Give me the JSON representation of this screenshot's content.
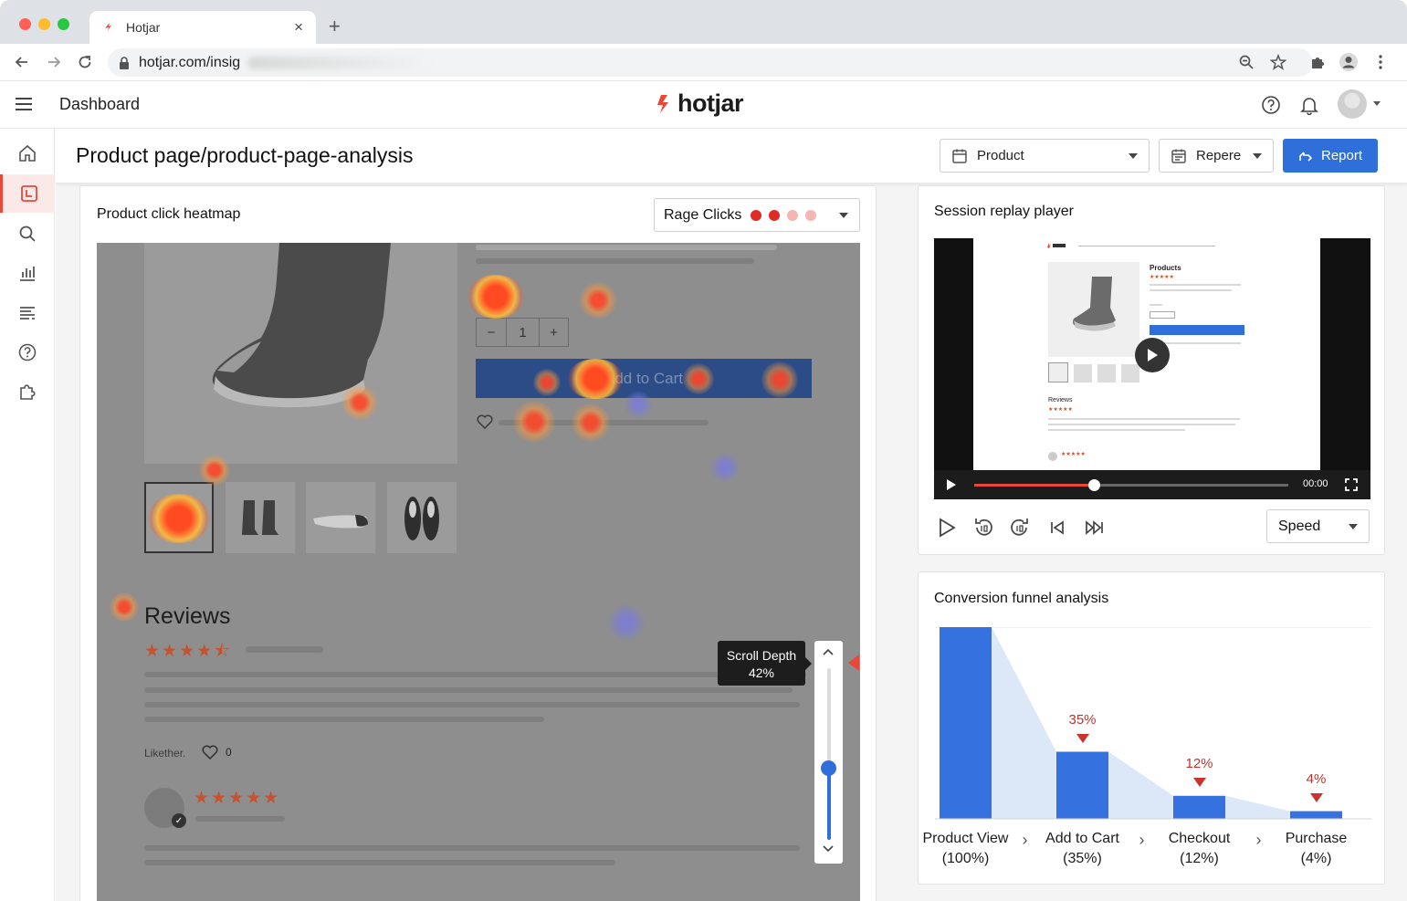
{
  "browser": {
    "tab_title": "Hotjar",
    "tab_close": "×",
    "new_tab": "+",
    "url": "hotjar.com/insig"
  },
  "app": {
    "header_title": "Dashboard",
    "logo_text": "hotjar",
    "brand_color": "#e8473a"
  },
  "page": {
    "title": "Product page/product-page-analysis",
    "filters": {
      "product_select": "Product",
      "repere_select": "Repere",
      "report_button": "Report"
    }
  },
  "heatmap_card": {
    "title": "Product click heatmap",
    "mode_select": "Rage Clicks",
    "mode_dots": [
      "#e02b25",
      "#e02b25",
      "#f4b6b2",
      "#f4b6b2"
    ],
    "page_preview": {
      "qty_minus": "−",
      "qty_value": "1",
      "qty_plus": "+",
      "add_to_cart": "Add to Cart",
      "reviews_title": "Reviews",
      "rating_stars": "★★★★⯪",
      "review_stars": "★★★★★",
      "likes_label": "Likether.",
      "likes_count": "0"
    },
    "scroll_depth": {
      "label": "Scroll Depth",
      "value": "42%",
      "level": 42
    }
  },
  "replay_card": {
    "title": "Session replay player",
    "time": "00:00",
    "progress_fraction": 0.38,
    "speed_select": "Speed",
    "mini_page": {
      "products_heading": "Products",
      "reviews_heading": "Reviews"
    }
  },
  "funnel_card": {
    "title": "Conversion funnel analysis",
    "bar_color": "#3572e0",
    "area_color": "#dce8f7",
    "chart_data": {
      "type": "bar",
      "categories": [
        "Product View",
        "Add to Cart",
        "Checkout",
        "Purchase"
      ],
      "values": [
        100,
        35,
        12,
        4
      ],
      "ylim": [
        0,
        100
      ],
      "data_labels": [
        "",
        "35%",
        "12%",
        "4%"
      ],
      "tick_labels": [
        [
          "Product View",
          "(100%)"
        ],
        [
          "Add to Cart",
          "(35%)"
        ],
        [
          "Checkout",
          "(12%)"
        ],
        [
          "Purchase",
          "(4%)"
        ]
      ]
    }
  }
}
